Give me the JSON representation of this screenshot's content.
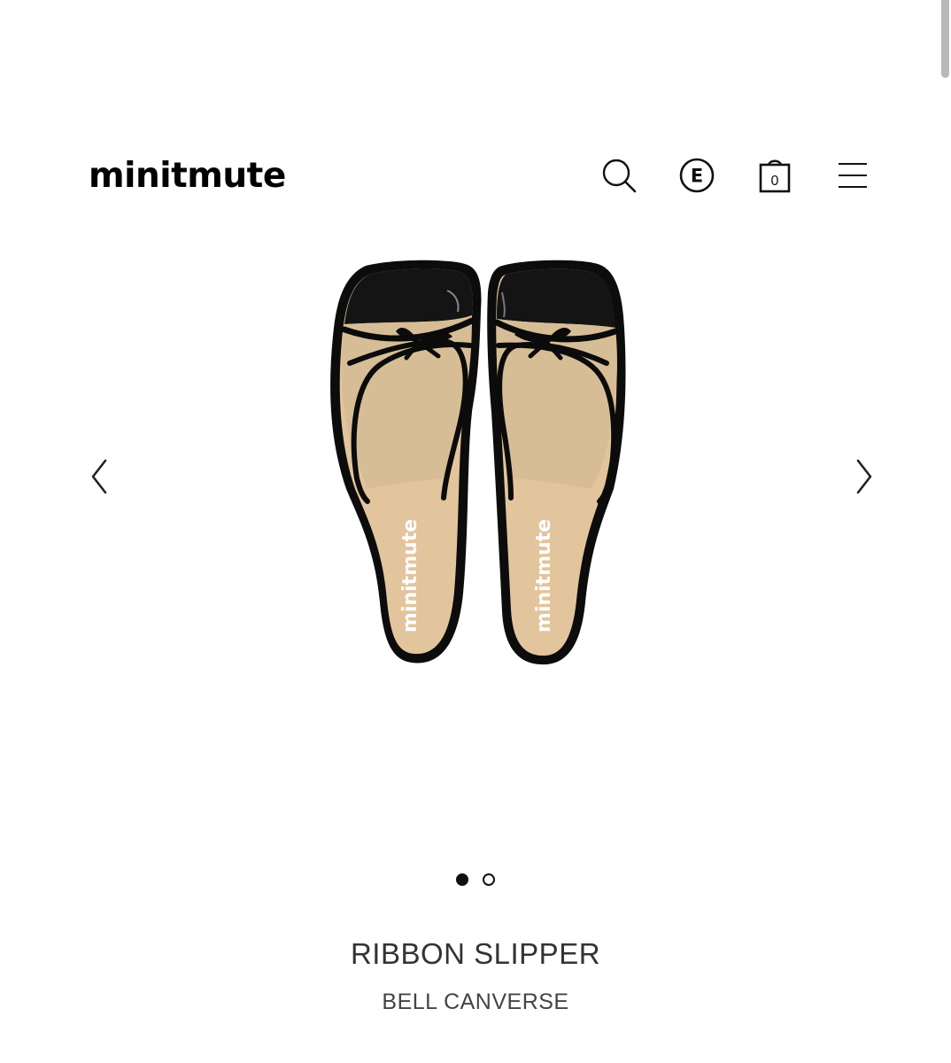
{
  "header": {
    "logo": "minitmute",
    "cart_count": "0",
    "language_badge": "E"
  },
  "gallery": {
    "insole_brand": "minitmute",
    "slides_total": 2,
    "active_slide": 1
  },
  "product": {
    "name": "RIBBON SLIPPER",
    "brand": "BELL CANVERSE"
  },
  "icons": {
    "search": "search-icon",
    "language": "language-e-icon",
    "cart": "shopping-bag-icon",
    "menu": "hamburger-menu-icon",
    "prev": "chevron-left-icon",
    "next": "chevron-right-icon"
  },
  "colors": {
    "text": "#111111",
    "canvas": "#d7bd96",
    "strap": "#0b0b0b",
    "insole": "#e2c49d"
  }
}
